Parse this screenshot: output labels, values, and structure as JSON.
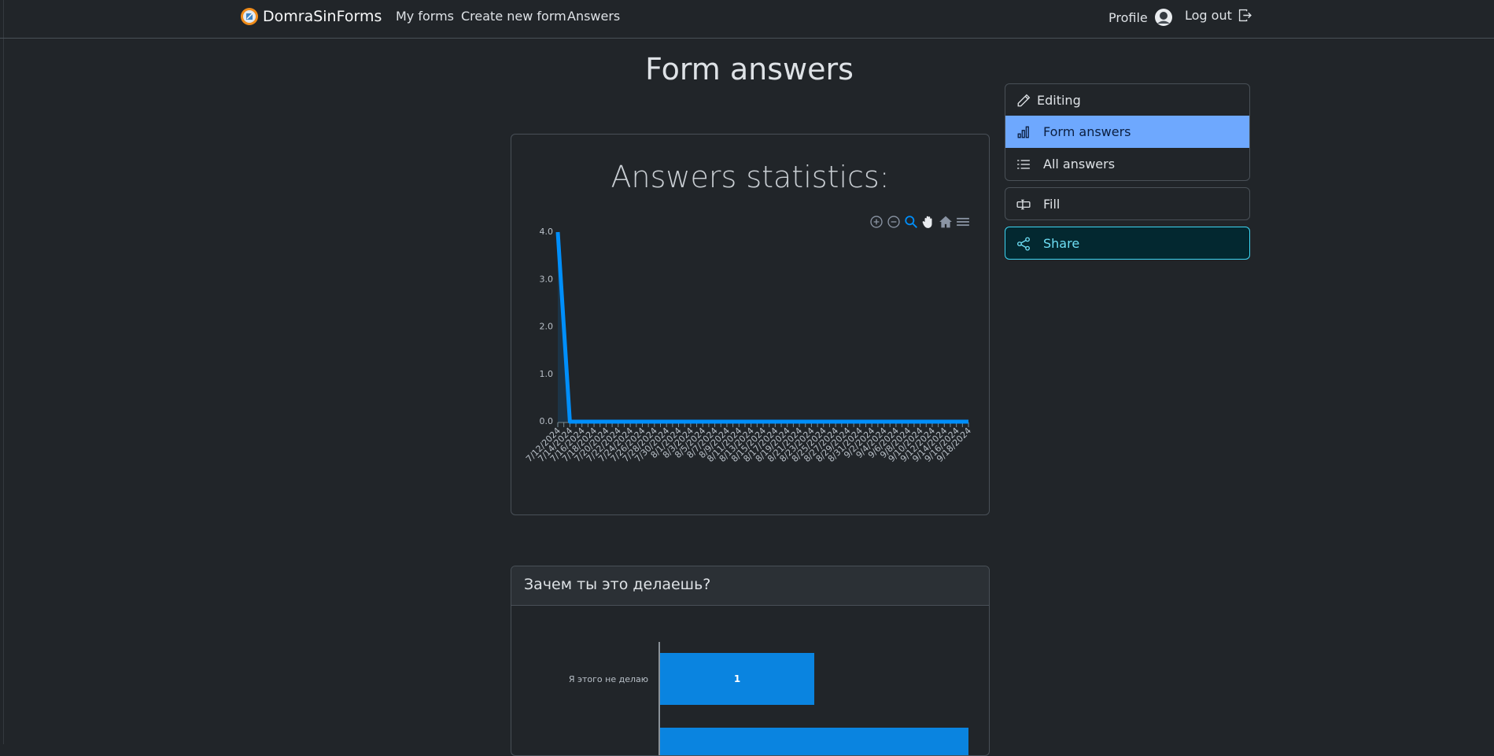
{
  "nav": {
    "brand": "DomraSinForms",
    "links": [
      "My forms",
      "Create new form",
      "Answers"
    ],
    "profile": "Profile",
    "logout": "Log out"
  },
  "page": {
    "title": "Form answers"
  },
  "side_menu": {
    "items": [
      {
        "label": "Editing",
        "icon": "pencil-icon"
      },
      {
        "label": "Form answers",
        "icon": "bar-chart-icon",
        "active": true
      },
      {
        "label": "All answers",
        "icon": "list-icon"
      }
    ],
    "fill": {
      "label": "Fill",
      "icon": "input-cursor-icon"
    },
    "share": {
      "label": "Share",
      "icon": "share-icon"
    }
  },
  "colors": {
    "accent": "#6ea8fe",
    "series": "#008ffb",
    "share": "#6edff6",
    "background": "#212529"
  },
  "chart_data": [
    {
      "type": "area",
      "title": "Answers statistics:",
      "x": [
        "7/12/2024",
        "7/14/2024",
        "7/16/2024",
        "7/18/2024",
        "7/20/2024",
        "7/22/2024",
        "7/24/2024",
        "7/26/2024",
        "7/28/2024",
        "7/30/2024",
        "8/1/2024",
        "8/3/2024",
        "8/5/2024",
        "8/7/2024",
        "8/9/2024",
        "8/11/2024",
        "8/13/2024",
        "8/15/2024",
        "8/17/2024",
        "8/19/2024",
        "8/21/2024",
        "8/23/2024",
        "8/25/2024",
        "8/27/2024",
        "8/29/2024",
        "8/31/2024",
        "9/2/2024",
        "9/4/2024",
        "9/6/2024",
        "9/8/2024",
        "9/10/2024",
        "9/12/2024",
        "9/14/2024",
        "9/16/2024",
        "9/18/2024"
      ],
      "y": [
        4,
        0,
        0,
        0,
        0,
        0,
        0,
        0,
        0,
        0,
        0,
        0,
        0,
        0,
        0,
        0,
        0,
        0,
        0,
        0,
        0,
        0,
        0,
        0,
        0,
        0,
        0,
        0,
        0,
        0,
        0,
        0,
        0,
        0,
        0
      ],
      "y_ticks": [
        "4.0",
        "3.0",
        "2.0",
        "1.0",
        "0.0"
      ],
      "ylim": [
        0,
        4
      ],
      "toolbar": [
        "zoom-in-icon",
        "zoom-out-icon",
        "zoom-selection-icon",
        "pan-icon",
        "reset-home-icon",
        "menu-icon"
      ]
    },
    {
      "type": "bar",
      "orientation": "horizontal",
      "title": "Зачем ты это делаешь?",
      "categories": [
        "Я этого не делаю",
        ""
      ],
      "values": [
        1,
        2
      ],
      "data_labels": [
        "1",
        ""
      ]
    }
  ]
}
